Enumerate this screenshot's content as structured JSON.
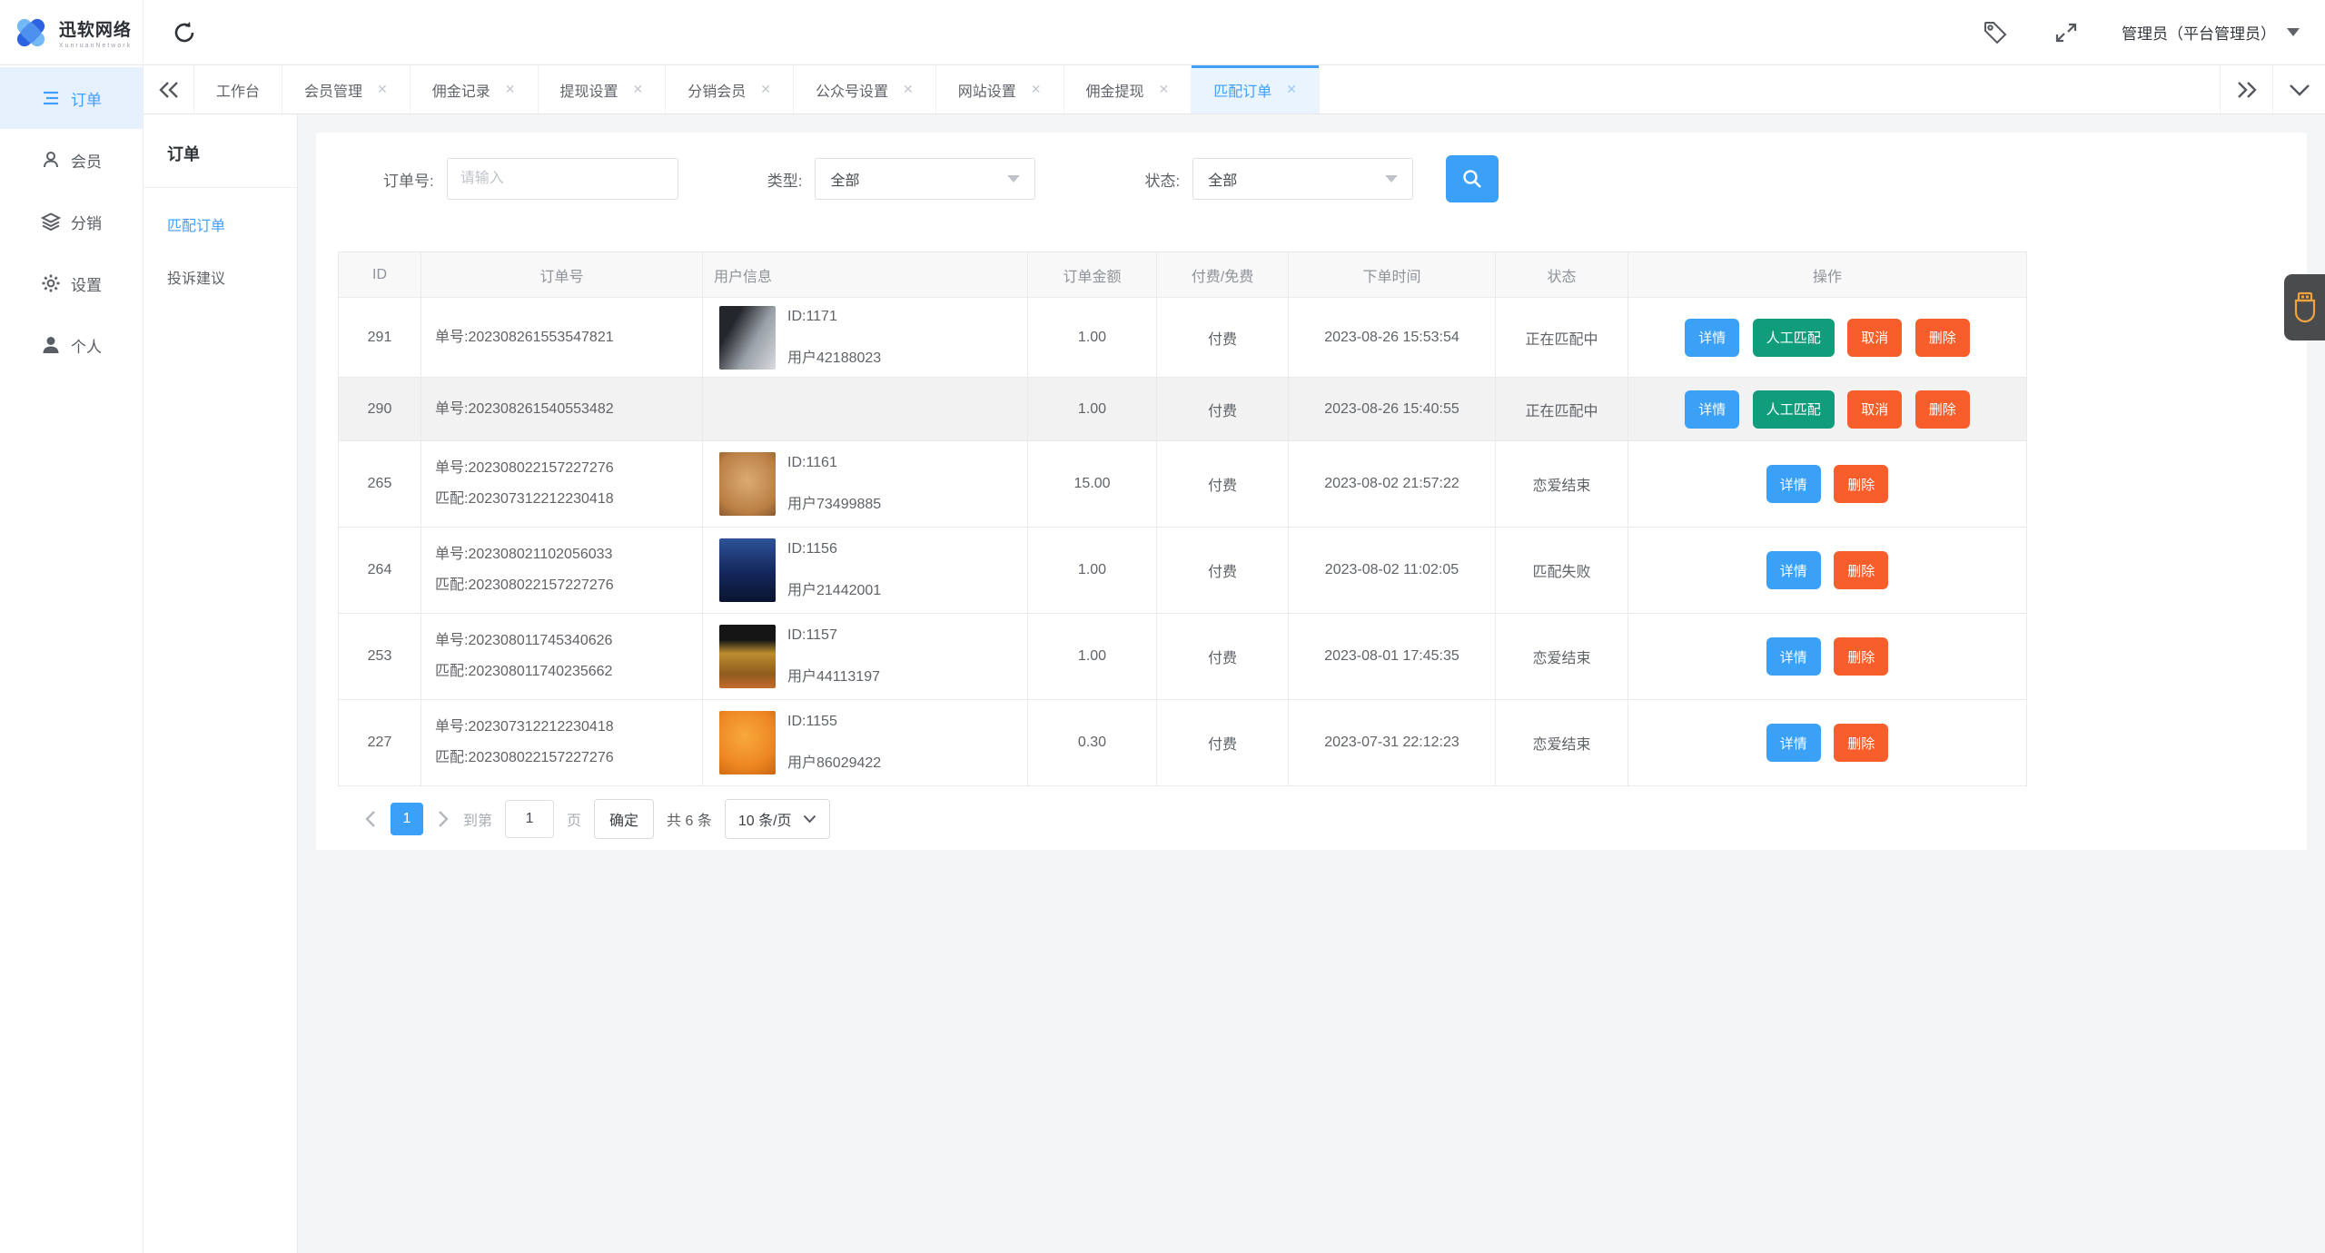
{
  "header": {
    "logo_title": "迅软网络",
    "logo_subtitle": "XunruanNetwork",
    "admin_label": "管理员（平台管理员）"
  },
  "sidebar": [
    {
      "label": "订单",
      "icon": "order-list-icon",
      "active": true
    },
    {
      "label": "会员",
      "icon": "member-icon"
    },
    {
      "label": "分销",
      "icon": "distribution-icon"
    },
    {
      "label": "设置",
      "icon": "settings-gear-icon"
    },
    {
      "label": "个人",
      "icon": "profile-icon"
    }
  ],
  "tabs": [
    "工作台",
    "会员管理",
    "佣金记录",
    "提现设置",
    "分销会员",
    "公众号设置",
    "网站设置",
    "佣金提现",
    "匹配订单"
  ],
  "submenu": {
    "title": "订单",
    "items": [
      "匹配订单",
      "投诉建议"
    ]
  },
  "filters": {
    "order_label": "订单号:",
    "order_placeholder": "请输入",
    "type_label": "类型:",
    "type_value": "全部",
    "status_label": "状态:",
    "status_value": "全部"
  },
  "table": {
    "columns": [
      "ID",
      "订单号",
      "用户信息",
      "订单金额",
      "付费/免费",
      "下单时间",
      "状态",
      "操作"
    ],
    "actions": {
      "detail": "详情",
      "manual": "人工匹配",
      "cancel": "取消",
      "delete": "删除"
    },
    "rows": [
      {
        "id": "291",
        "order_no": "单号:202308261553547821",
        "match_no": "",
        "user_id": "ID:1171",
        "user_name": "用户42188023",
        "amount": "1.00",
        "pay_type": "付费",
        "time": "2023-08-26 15:53:54",
        "status": "正在匹配中"
      },
      {
        "id": "290",
        "order_no": "单号:202308261540553482",
        "match_no": "",
        "user_id": "",
        "user_name": "",
        "amount": "1.00",
        "pay_type": "付费",
        "time": "2023-08-26 15:40:55",
        "status": "正在匹配中"
      },
      {
        "id": "265",
        "order_no": "单号:202308022157227276",
        "match_no": "匹配:202307312212230418",
        "user_id": "ID:1161",
        "user_name": "用户73499885",
        "amount": "15.00",
        "pay_type": "付费",
        "time": "2023-08-02 21:57:22",
        "status": "恋爱结束"
      },
      {
        "id": "264",
        "order_no": "单号:202308021102056033",
        "match_no": "匹配:202308022157227276",
        "user_id": "ID:1156",
        "user_name": "用户21442001",
        "amount": "1.00",
        "pay_type": "付费",
        "time": "2023-08-02 11:02:05",
        "status": "匹配失败"
      },
      {
        "id": "253",
        "order_no": "单号:202308011745340626",
        "match_no": "匹配:202308011740235662",
        "user_id": "ID:1157",
        "user_name": "用户44113197",
        "amount": "1.00",
        "pay_type": "付费",
        "time": "2023-08-01 17:45:35",
        "status": "恋爱结束"
      },
      {
        "id": "227",
        "order_no": "单号:202307312212230418",
        "match_no": "匹配:202308022157227276",
        "user_id": "ID:1155",
        "user_name": "用户86029422",
        "amount": "0.30",
        "pay_type": "付费",
        "time": "2023-07-31 22:12:23",
        "status": "恋爱结束"
      }
    ]
  },
  "pagination": {
    "current_page": "1",
    "goto_label": "到第",
    "goto_value": "1",
    "page_unit": "页",
    "confirm_label": "确定",
    "total_label": "共 6 条",
    "page_size": "10 条/页"
  },
  "colors": {
    "accent_blue": "#409eff",
    "button_green": "#0f9d7c",
    "button_orange": "#f85d2c",
    "alert_red": "#e23c3c"
  }
}
